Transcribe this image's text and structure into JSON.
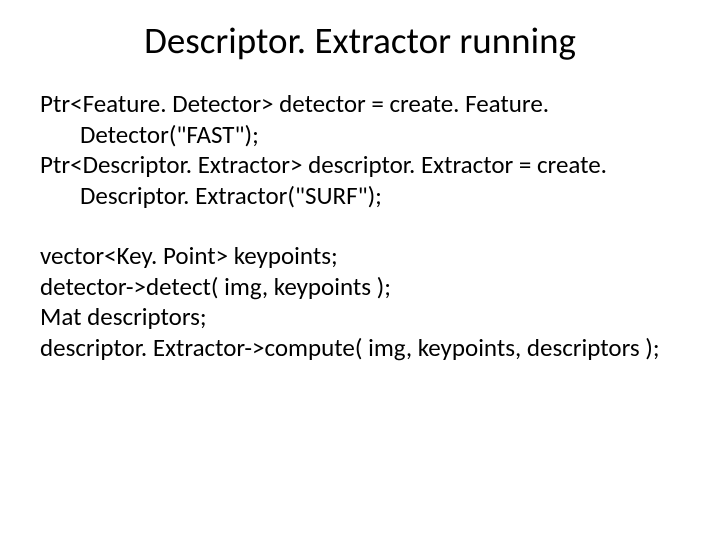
{
  "title": "Descriptor. Extractor running",
  "code": {
    "l1": "Ptr<Feature. Detector> detector = create. Feature. Detector(\"FAST\");",
    "l2": "Ptr<Descriptor. Extractor> descriptor. Extractor = create. Descriptor. Extractor(\"SURF\");",
    "l3": "vector<Key. Point> keypoints;",
    "l4": "detector->detect( img, keypoints );",
    "l5": "Mat descriptors;",
    "l6": "descriptor. Extractor->compute( img, keypoints, descriptors );"
  }
}
